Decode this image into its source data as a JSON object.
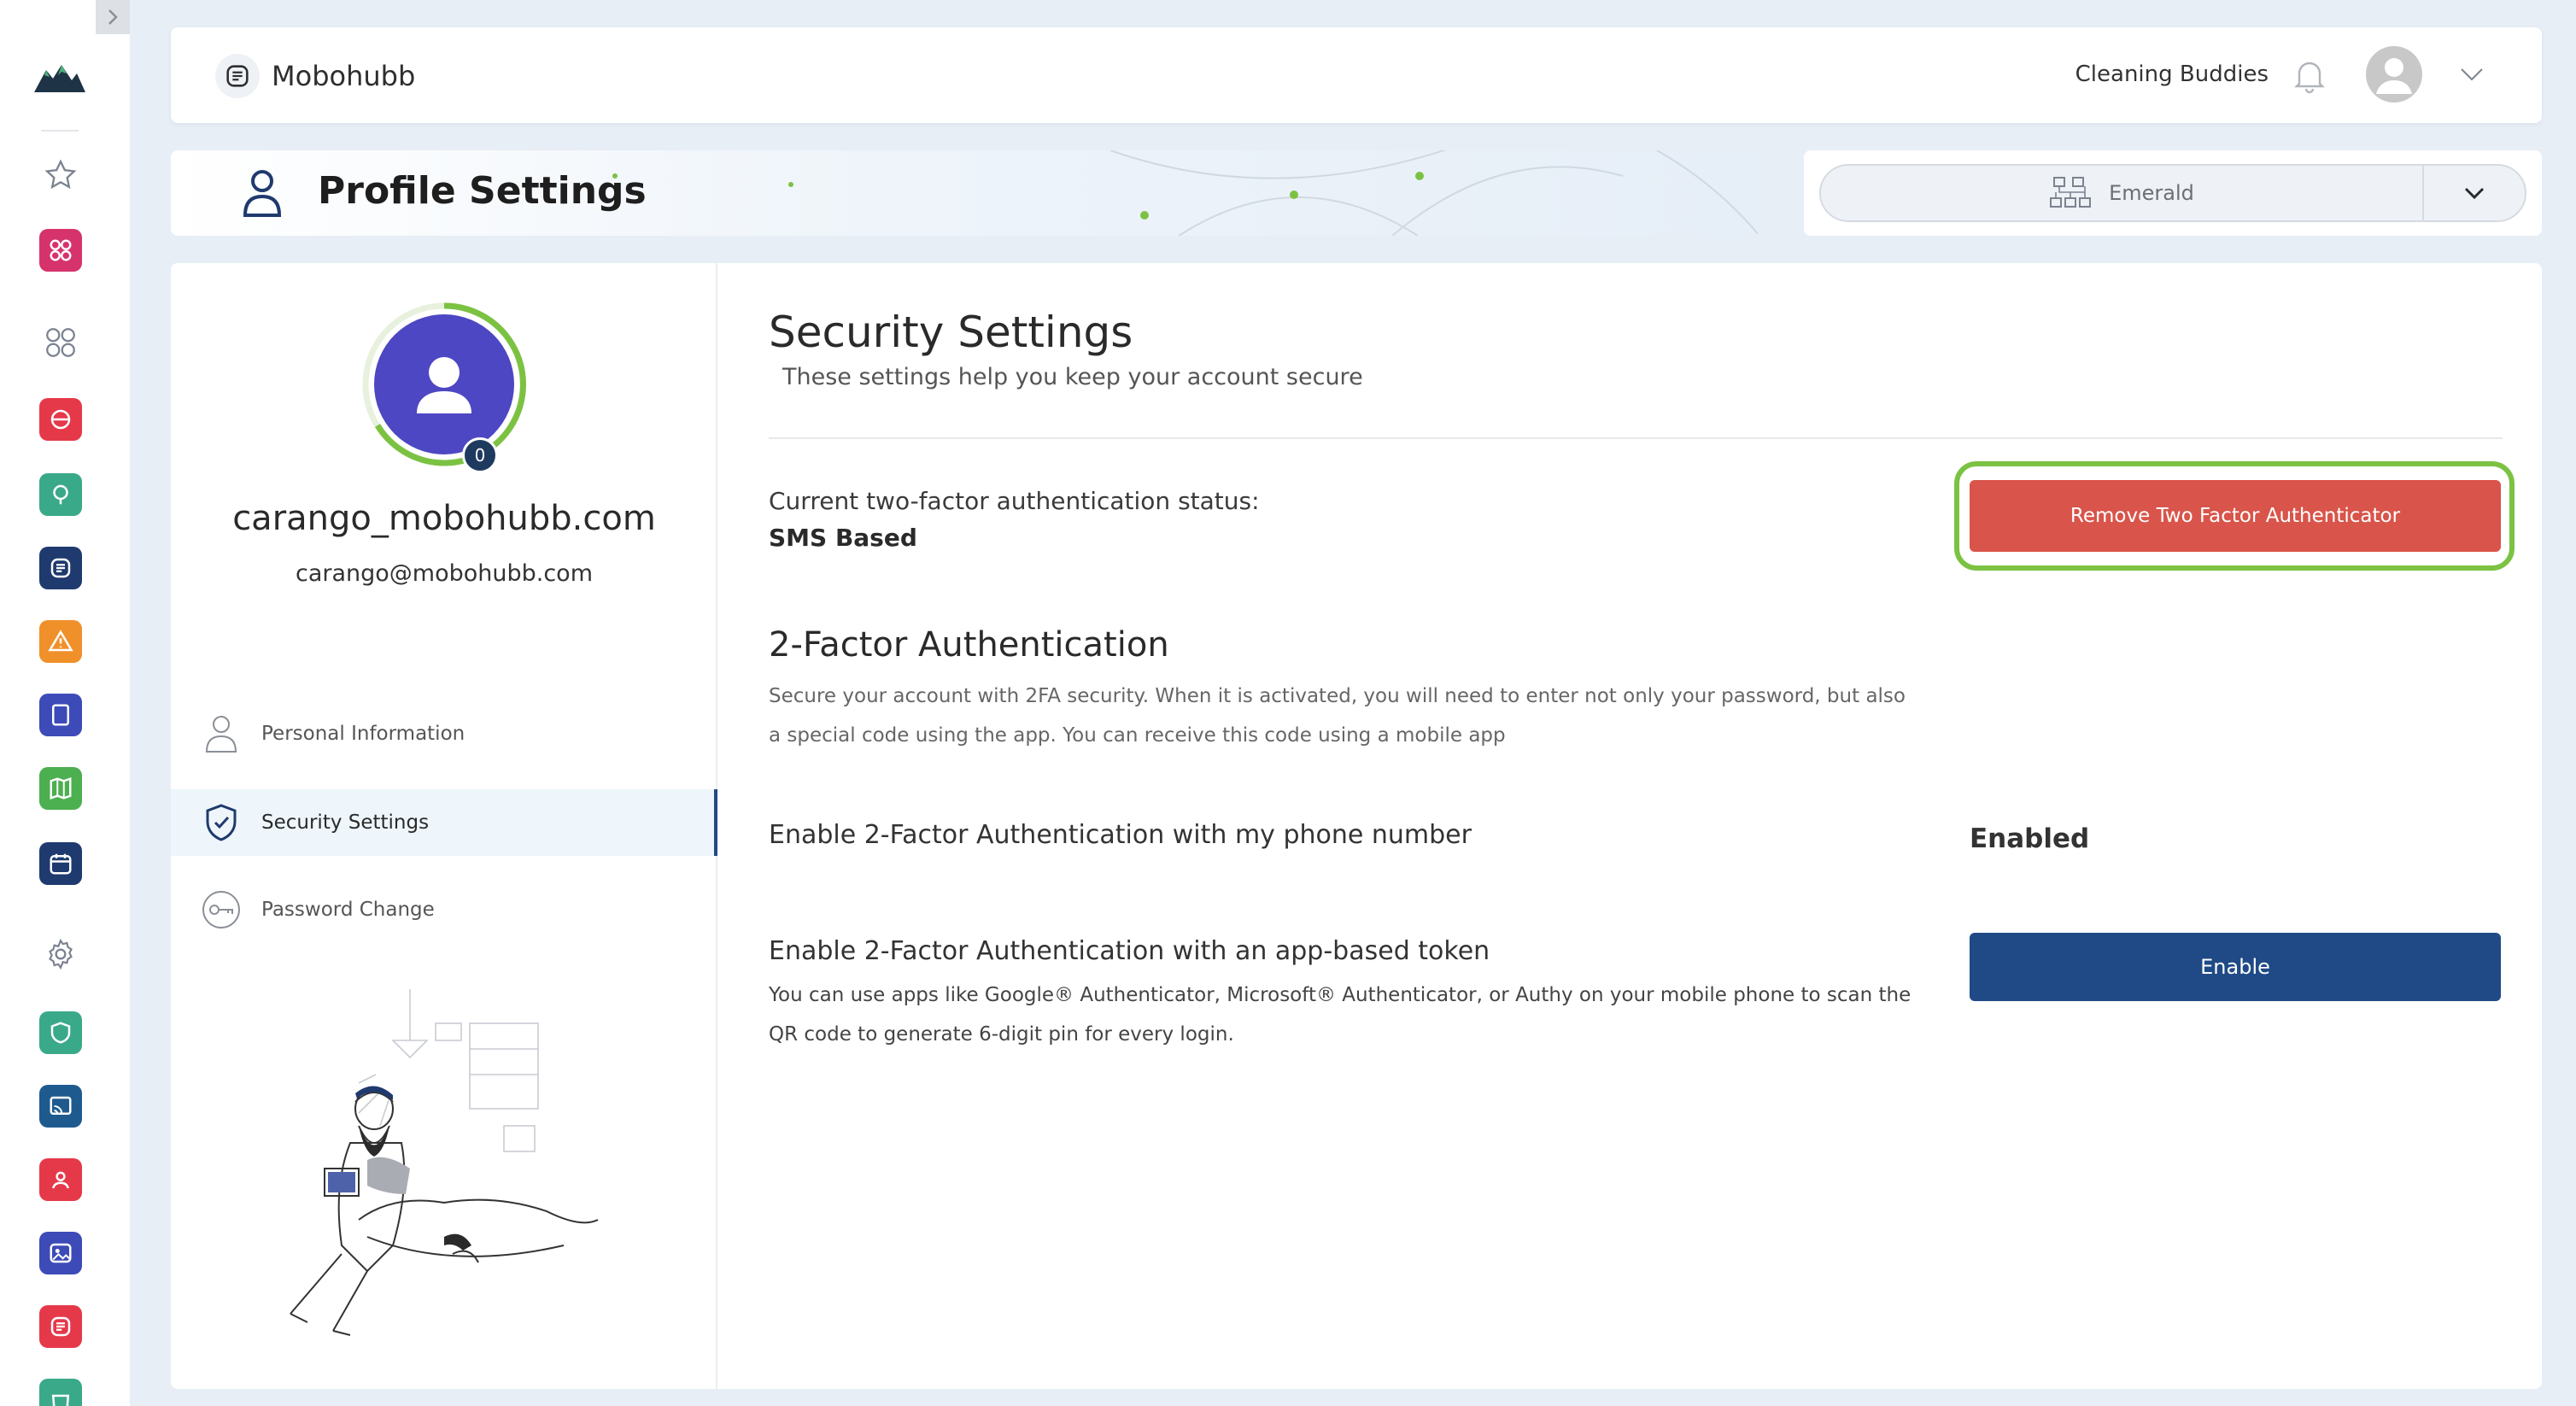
{
  "app": {
    "brand_name": "Mobohubb",
    "org_name": "Cleaning Buddies"
  },
  "banner": {
    "title": "Profile Settings"
  },
  "workspace": {
    "selected": "Emerald"
  },
  "profile": {
    "username": "carango_mobohubb.com",
    "email": "carango@mobohubb.com",
    "badge_count": "0"
  },
  "nav": {
    "items": [
      {
        "label": "Personal Information",
        "icon": "person-icon"
      },
      {
        "label": "Security Settings",
        "icon": "shield-check-icon"
      },
      {
        "label": "Password Change",
        "icon": "key-icon"
      }
    ]
  },
  "security": {
    "title": "Security Settings",
    "subtitle": "These settings help you keep your account secure",
    "status_label": "Current two-factor authentication status:",
    "status_value": "SMS Based",
    "remove_button": "Remove Two Factor Authenticator",
    "twofa_title": "2-Factor Authentication",
    "twofa_desc": "Secure your account with 2FA security. When it is activated, you will need to enter not only your password, but also a special code using the app. You can receive this code using a mobile app",
    "phone_label": "Enable 2-Factor Authentication with my phone number",
    "phone_state": "Enabled",
    "app_label": "Enable 2-Factor Authentication with an app-based token",
    "app_desc": "You can use apps like Google® Authenticator, Microsoft® Authenticator, or Authy on your mobile phone to scan the QR code to generate 6-digit pin for every login.",
    "enable_button": "Enable"
  },
  "colors": {
    "primary_blue": "#1f4a86",
    "danger_red": "#d9544a",
    "highlight_green": "#7cc242",
    "avatar_purple": "#4d47c3"
  },
  "rail_icons": [
    "star-icon",
    "apps-icon",
    "grid-outline-icon",
    "scan-icon",
    "lightbulb-icon",
    "document-icon",
    "warning-icon",
    "tablet-icon",
    "map-icon",
    "calendar-icon",
    "gear-icon",
    "shield-icon",
    "cast-icon",
    "team-icon",
    "image-icon",
    "form-icon",
    "bag-icon"
  ]
}
